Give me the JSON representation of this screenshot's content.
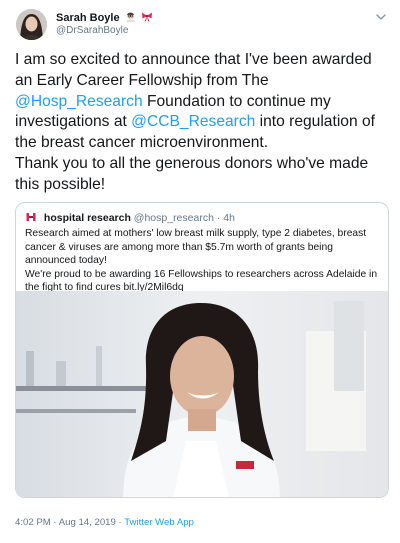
{
  "author": {
    "name": "Sarah Boyle",
    "handle": "@DrSarahBoyle",
    "emoji_icons": [
      "scientist-icon",
      "ribbon-icon"
    ]
  },
  "tweet": {
    "parts": [
      "I am so excited to announce that I've been awarded an Early Career Fellowship from The ",
      "@Hosp_Research",
      " Foundation to continue my investigations at ",
      "@CCB_Research",
      " into regulation of the breast cancer microenvironment.",
      "Thank you to all the generous donors who've made this possible!"
    ]
  },
  "quoted": {
    "name": "hospital research",
    "handle": "@hosp_research",
    "separator": "·",
    "time": "4h",
    "text_1": "Research aimed at mothers' low breast milk supply, type 2 diabetes, breast cancer & viruses are among more than $5.7m worth of grants being announced today!",
    "text_2": "We're proud to be awarding 16 Fellowships to researchers across Adelaide in the fight to find cures bit.ly/2Mil6dq"
  },
  "meta": {
    "time": "4:02 PM",
    "separator": "·",
    "date": "Aug 14, 2019",
    "app": "Twitter Web App"
  },
  "colors": {
    "link": "#1da1f2",
    "secondary_text": "#657786",
    "border": "#ccd6dd"
  }
}
